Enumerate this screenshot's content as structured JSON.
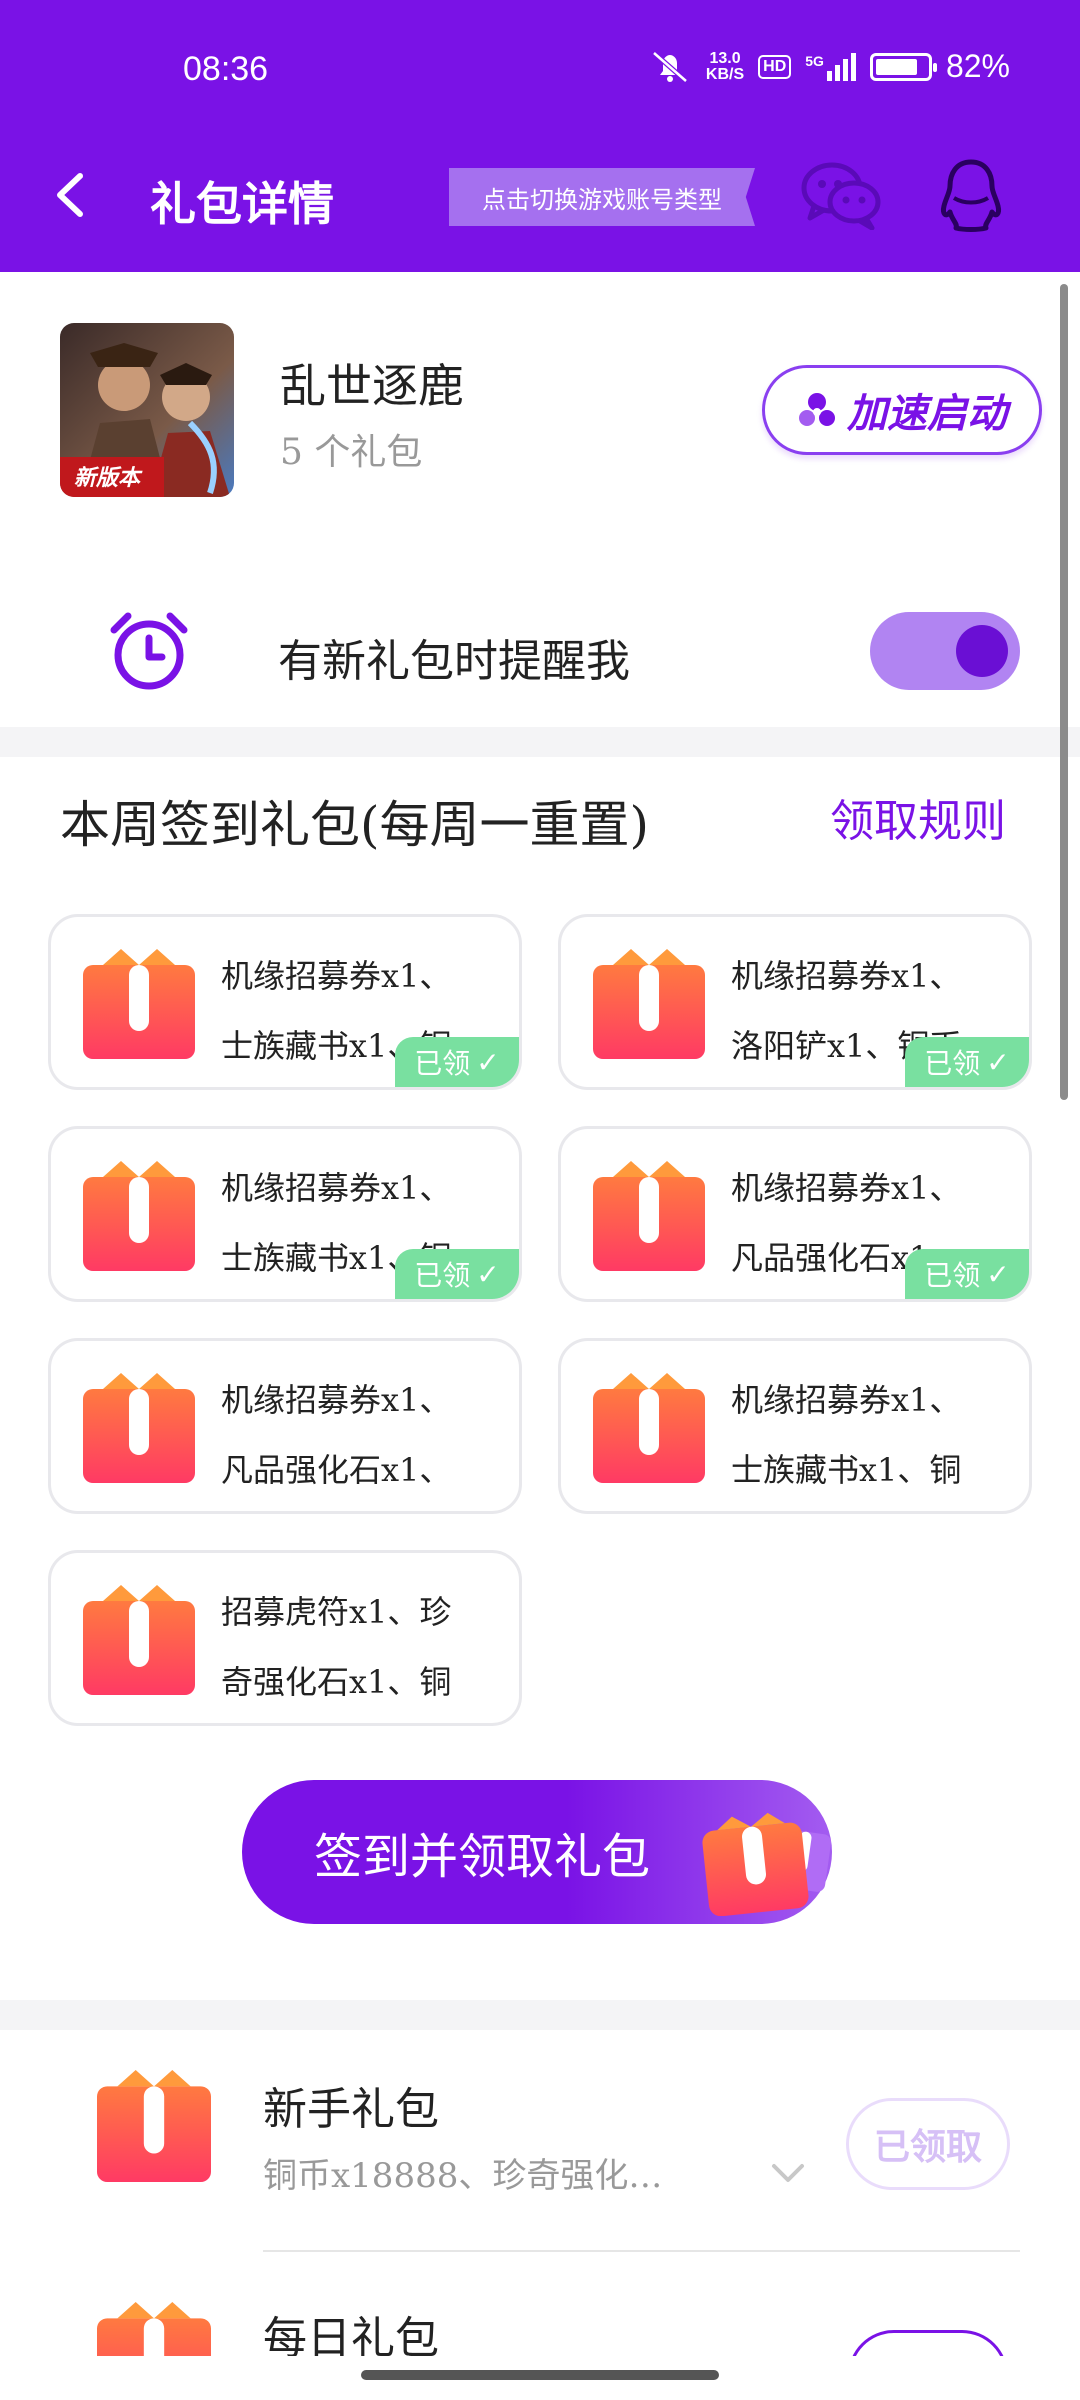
{
  "status_bar": {
    "time": "08:36",
    "net_speed": "13.0",
    "net_unit": "KB/S",
    "hd": "HD",
    "network": "5G",
    "battery": "82%",
    "battery_level": 0.82
  },
  "header": {
    "title": "礼包详情",
    "switch_account_label": "点击切换游戏账号类型"
  },
  "game": {
    "name": "乱世逐鹿",
    "gift_count": "5 个礼包",
    "boost_label": "加速启动",
    "thumb_badge": "新版本"
  },
  "reminder": {
    "label": "有新礼包时提醒我",
    "enabled": true
  },
  "weekly": {
    "title": "本周签到礼包(每周一重置)",
    "rules_label": "领取规则",
    "claimed_label": "已领",
    "gifts": [
      {
        "line1": "机缘招募券x1、",
        "line2": "士族藏书x1、铜",
        "claimed": true
      },
      {
        "line1": "机缘招募券x1、",
        "line2": "洛阳铲x1、铜币",
        "claimed": true
      },
      {
        "line1": "机缘招募券x1、",
        "line2": "士族藏书x1、铜",
        "claimed": true
      },
      {
        "line1": "机缘招募券x1、",
        "line2": "凡品强化石x1、",
        "claimed": true
      },
      {
        "line1": "机缘招募券x1、",
        "line2": "凡品强化石x1、",
        "claimed": false
      },
      {
        "line1": "机缘招募券x1、",
        "line2": "士族藏书x1、铜",
        "claimed": false
      },
      {
        "line1": "招募虎符x1、珍",
        "line2": "奇强化石x1、铜",
        "claimed": false
      }
    ],
    "signin_button": "签到并领取礼包"
  },
  "gift_list": [
    {
      "title": "新手礼包",
      "desc": "铜币x18888、珍奇强化…",
      "status": "已领取"
    },
    {
      "title": "每日礼包"
    }
  ],
  "colors": {
    "brand": "#7a12e6",
    "toggle_track": "#b184f2",
    "claimed_tag": "#79e0a0",
    "gift_red": "#ff4f5e",
    "gift_orange": "#ff8a3d"
  }
}
